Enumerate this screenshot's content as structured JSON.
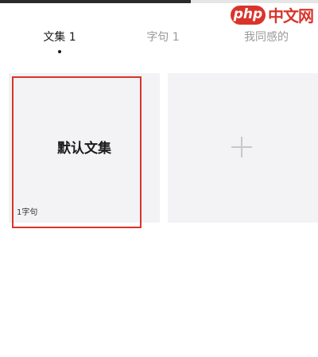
{
  "watermark": {
    "badge_text": "php",
    "text": "中文网"
  },
  "progress": {
    "fraction": 0.6
  },
  "tabs": [
    {
      "label": "文集 1",
      "active": true
    },
    {
      "label": "字句 1",
      "active": false
    },
    {
      "label": "我同感的",
      "active": false
    }
  ],
  "collections": [
    {
      "title": "默认文集",
      "count": "1字句"
    }
  ],
  "add_card": {
    "icon": "plus-icon"
  },
  "colors": {
    "highlight": "#d9342b",
    "card_bg": "#f3f2f4",
    "accent": "#1a1a1a"
  }
}
